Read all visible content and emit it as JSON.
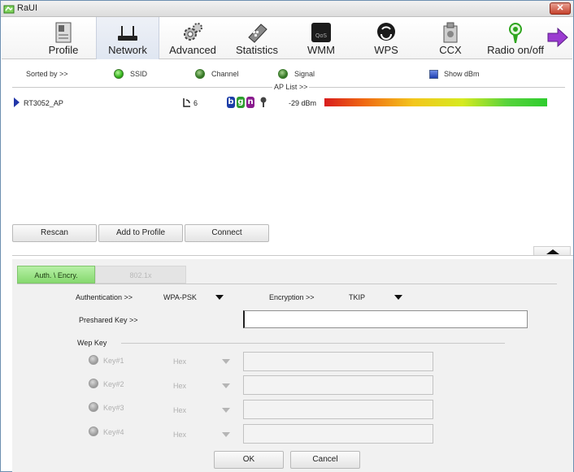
{
  "window": {
    "title": "RaUI",
    "close_symbol": "✕"
  },
  "toolbar": {
    "items": [
      {
        "label": "Profile",
        "icon": "profile-icon"
      },
      {
        "label": "Network",
        "icon": "network-icon",
        "active": true
      },
      {
        "label": "Advanced",
        "icon": "advanced-gears-icon"
      },
      {
        "label": "Statistics",
        "icon": "statistics-icon"
      },
      {
        "label": "WMM",
        "icon": "wmm-icon"
      },
      {
        "label": "WPS",
        "icon": "wps-icon"
      },
      {
        "label": "CCX",
        "icon": "ccx-icon"
      },
      {
        "label": "Radio on/off",
        "icon": "radio-icon"
      }
    ],
    "more": "more-arrow-icon"
  },
  "sort": {
    "label": "Sorted by >>",
    "options": [
      {
        "label": "SSID",
        "selected": true
      },
      {
        "label": "Channel",
        "selected": false
      },
      {
        "label": "Signal",
        "selected": false
      }
    ],
    "show_dbm_label": "Show dBm",
    "show_dbm_checked": true
  },
  "ap_list": {
    "title": "AP List >>",
    "rows": [
      {
        "ssid": "RT3052_AP",
        "channel": "6",
        "modes": [
          "b",
          "g",
          "n"
        ],
        "secured": true,
        "signal": "-29 dBm",
        "signal_level": 0.95
      }
    ]
  },
  "buttons": {
    "rescan": "Rescan",
    "add_to_profile": "Add to Profile",
    "connect": "Connect",
    "ok": "OK",
    "cancel": "Cancel"
  },
  "tabs": {
    "auth": "Auth. \\ Encry.",
    "dot1x": "802.1x"
  },
  "security": {
    "auth_label": "Authentication >>",
    "auth_value": "WPA-PSK",
    "enc_label": "Encryption >>",
    "enc_value": "TKIP",
    "psk_label": "Preshared Key >>",
    "psk_value": "",
    "wep_label": "Wep Key",
    "keys": [
      {
        "label": "Key#1",
        "format": "Hex"
      },
      {
        "label": "Key#2",
        "format": "Hex"
      },
      {
        "label": "Key#3",
        "format": "Hex"
      },
      {
        "label": "Key#4",
        "format": "Hex"
      }
    ]
  },
  "colors": {
    "accent_green": "#86d96f",
    "badge_b": "#1d3ea8",
    "badge_g": "#2e9e2e",
    "badge_n": "#8a1c8e"
  }
}
